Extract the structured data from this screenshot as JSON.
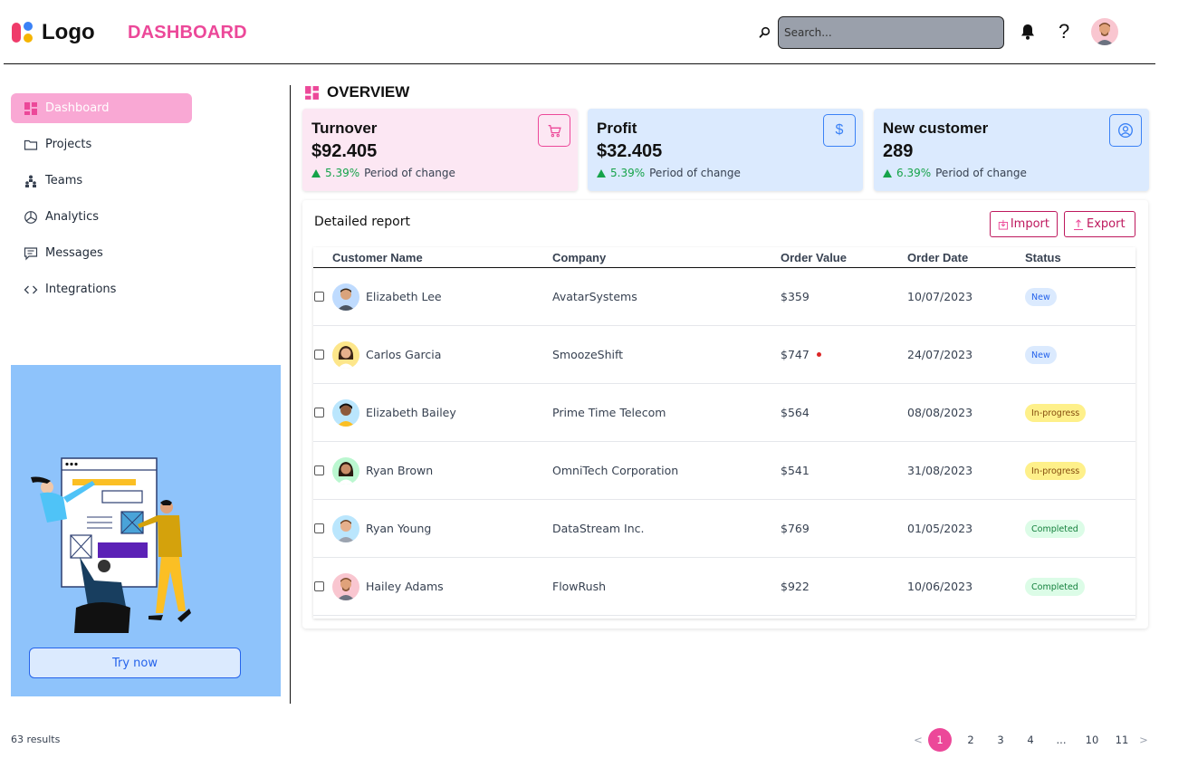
{
  "header": {
    "logo_text": "Logo",
    "page_heading": "DASHBOARD",
    "search_placeholder": "Search...",
    "help_label": "?"
  },
  "sidebar": {
    "items": [
      {
        "label": "Dashboard",
        "icon": "dashboard-icon",
        "active": true
      },
      {
        "label": "Projects",
        "icon": "folder-icon",
        "active": false
      },
      {
        "label": "Teams",
        "icon": "teams-icon",
        "active": false
      },
      {
        "label": "Analytics",
        "icon": "pie-chart-icon",
        "active": false
      },
      {
        "label": "Messages",
        "icon": "message-icon",
        "active": false
      },
      {
        "label": "Integrations",
        "icon": "code-icon",
        "active": false
      }
    ],
    "promo": {
      "button_label": "Try now"
    }
  },
  "overview": {
    "title": "OVERVIEW",
    "cards": [
      {
        "title": "Turnover",
        "value": "$92.405",
        "change": "5.39%",
        "change_label": "Period of change",
        "icon": "cart-icon"
      },
      {
        "title": "Profit",
        "value": "$32.405",
        "change": "5.39%",
        "change_label": "Period of change",
        "icon": "dollar-icon"
      },
      {
        "title": "New customer",
        "value": "289",
        "change": "6.39%",
        "change_label": "Period of change",
        "icon": "user-circle-icon"
      }
    ]
  },
  "report": {
    "title": "Detailed report",
    "import_label": "Import",
    "export_label": "Export",
    "columns": [
      "Customer Name",
      "Company",
      "Order Value",
      "Order Date",
      "Status"
    ],
    "rows": [
      {
        "name": "Elizabeth Lee",
        "company": "AvatarSystems",
        "value": "$359",
        "date": "10/07/2023",
        "status": "New"
      },
      {
        "name": "Carlos Garcia",
        "company": "SmoozeShift",
        "value": "$747",
        "date": "24/07/2023",
        "status": "New"
      },
      {
        "name": "Elizabeth Bailey",
        "company": "Prime Time Telecom",
        "value": "$564",
        "date": "08/08/2023",
        "status": "In-progress"
      },
      {
        "name": "Ryan Brown",
        "company": "OmniTech Corporation",
        "value": "$541",
        "date": "31/08/2023",
        "status": "In-progress"
      },
      {
        "name": "Ryan Young",
        "company": "DataStream Inc.",
        "value": "$769",
        "date": "01/05/2023",
        "status": "Completed"
      },
      {
        "name": "Hailey Adams",
        "company": "FlowRush",
        "value": "$922",
        "date": "10/06/2023",
        "status": "Completed"
      }
    ]
  },
  "footer": {
    "results": "63 results",
    "pages": [
      "<",
      "1",
      "2",
      "3",
      "4",
      "...",
      "10",
      "11",
      ">"
    ],
    "current_page": "1"
  },
  "colors": {
    "accent": "#ec4899",
    "active_nav": "#f9a8d4",
    "promo_bg": "#8ec3fb",
    "card_pink": "#fce7f3",
    "card_blue": "#dbeafe",
    "positive": "#16a34a"
  }
}
